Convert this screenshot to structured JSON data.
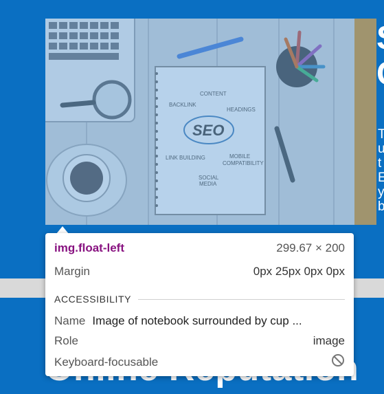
{
  "page": {
    "heading_behind": "Online Reputation",
    "side_heading": "S\nC",
    "side_text": "T\nu\nt\nE\ny\nb"
  },
  "image": {
    "alt_description": "Image of notebook surrounded by cup",
    "notebook_words": [
      "CONTENT",
      "BACKLINK",
      "HEADINGS",
      "SEO",
      "LINK BUILDING",
      "MOBILE",
      "COMPATIBILITY",
      "SOCIAL",
      "MEDIA"
    ]
  },
  "tooltip": {
    "selector": "img.float-left",
    "size": "299.67 × 200",
    "margin_label": "Margin",
    "margin_value": "0px 25px 0px 0px",
    "section_title": "ACCESSIBILITY",
    "name_label": "Name",
    "name_value": "Image of notebook surrounded by cup ...",
    "role_label": "Role",
    "role_value": "image",
    "focus_label": "Keyboard-focusable",
    "focus_icon": "not-allowed-icon"
  },
  "colors": {
    "page_blue": "#0a6fc2",
    "selector_purple": "#881280",
    "highlight_overlay": "#6fa8dc"
  }
}
